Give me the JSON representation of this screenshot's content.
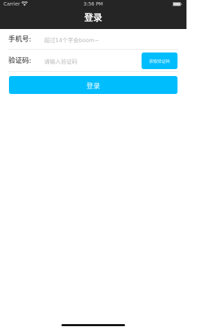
{
  "status_bar": {
    "carrier": "Carrier",
    "time": "3:56 PM",
    "wifi_icon": "wifi-icon",
    "battery_icon": "battery-icon"
  },
  "nav": {
    "title": "登录"
  },
  "form": {
    "phone_label": "手机号:",
    "phone_placeholder": "超过14个字会boom~",
    "phone_value": "",
    "code_label": "验证码:",
    "code_placeholder": "请输入验证码",
    "code_value": "",
    "get_code_label": "获取验证码",
    "login_label": "登录"
  },
  "colors": {
    "nav_background": "#252525",
    "accent": "#00bdfe",
    "divider": "#ececec",
    "placeholder": "#b9b9b9"
  }
}
